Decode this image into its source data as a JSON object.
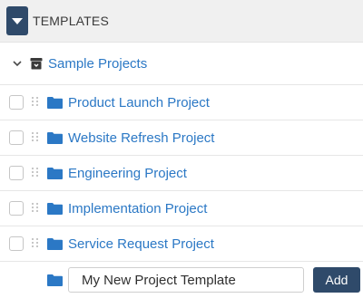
{
  "header": {
    "title": "TEMPLATES",
    "collapse_icon": "caret-down-icon"
  },
  "group": {
    "label": "Sample Projects",
    "icon": "archive-box-icon",
    "expanded": true
  },
  "items": [
    {
      "label": "Product Launch Project"
    },
    {
      "label": "Website Refresh Project"
    },
    {
      "label": "Engineering Project"
    },
    {
      "label": "Implementation Project"
    },
    {
      "label": "Service Request Project"
    }
  ],
  "new_template": {
    "value": "My New Project Template",
    "add_label": "Add"
  },
  "colors": {
    "accent": "#2f4a6a",
    "link": "#2b78c5",
    "folder": "#2b78c5"
  }
}
